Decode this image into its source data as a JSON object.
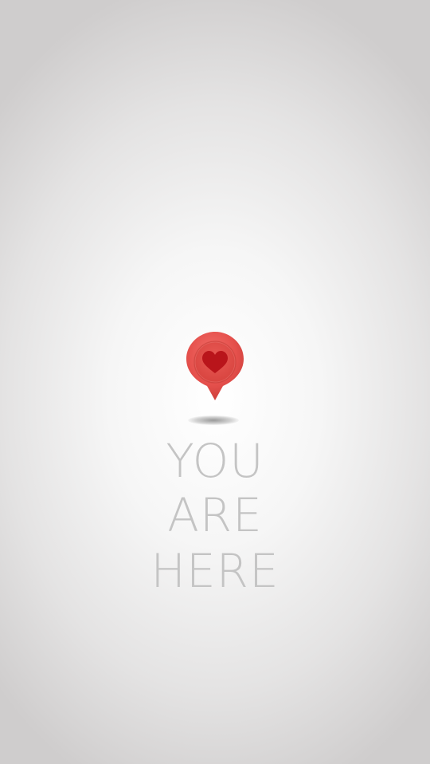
{
  "headline": {
    "line1": "YOU",
    "line2": "ARE",
    "line3": "HERE"
  },
  "pin": {
    "icon": "heart-location-pin-icon",
    "color": "#e8534f",
    "heart_color": "#c0161c"
  }
}
